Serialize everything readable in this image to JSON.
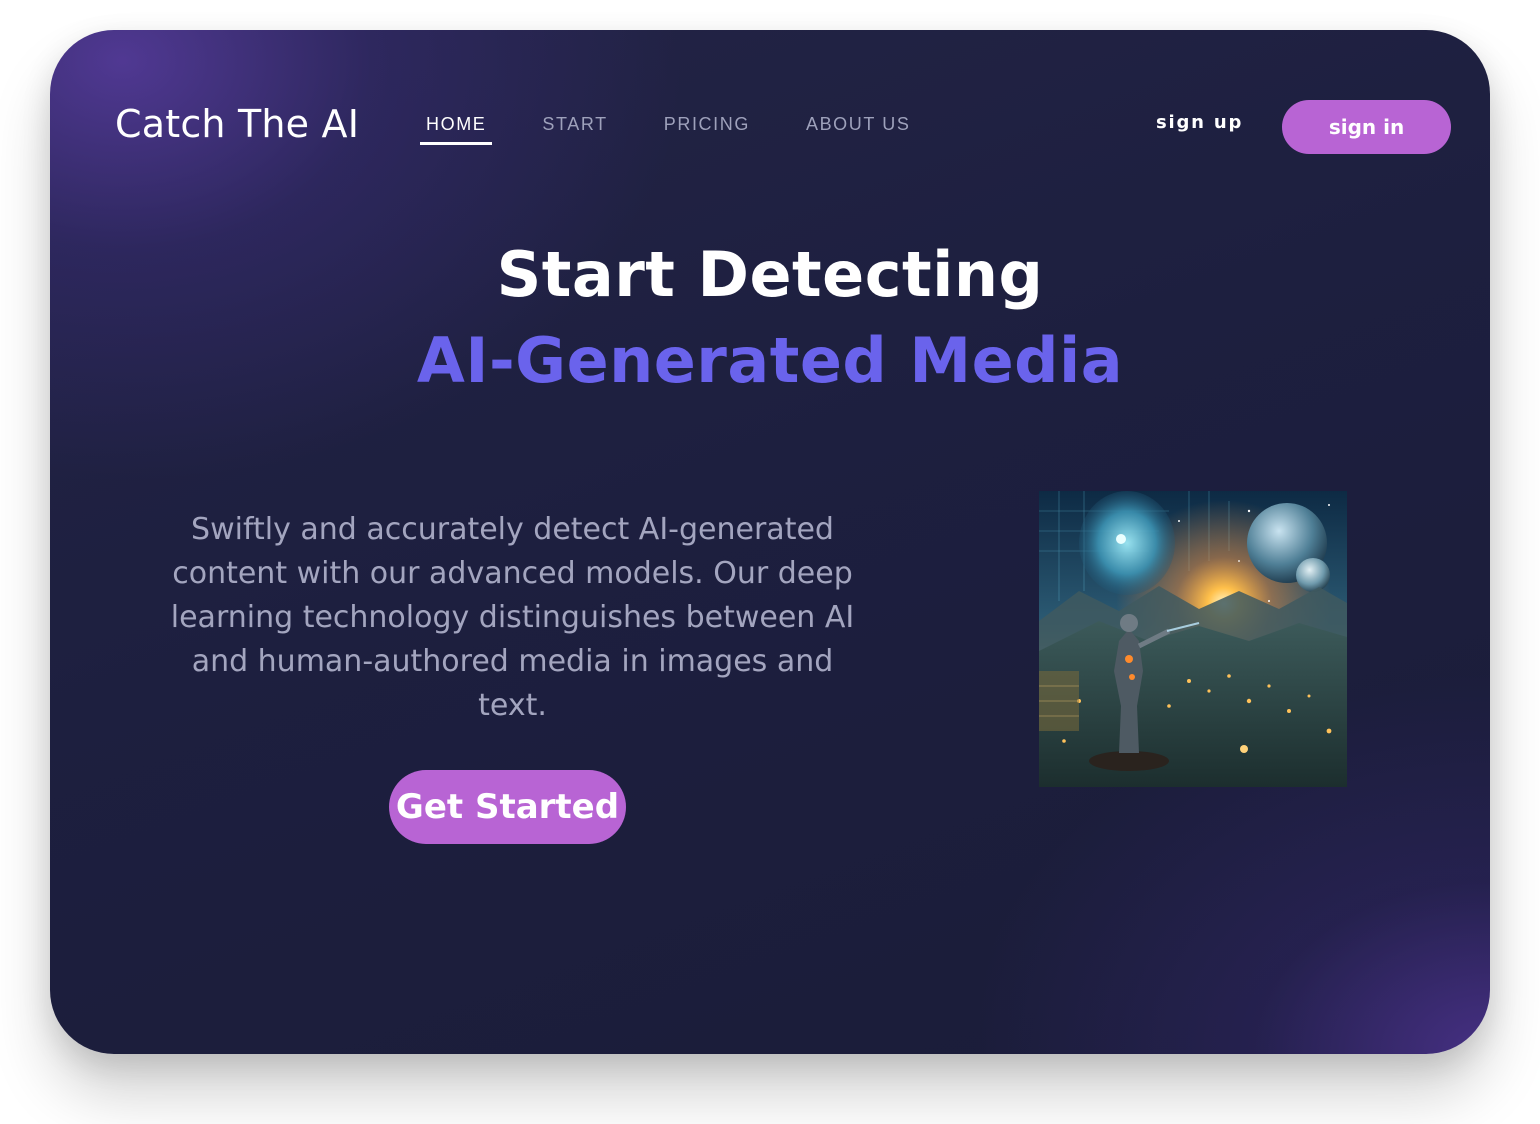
{
  "header": {
    "logo": "Catch The AI",
    "nav": [
      {
        "label": "HOME",
        "active": true
      },
      {
        "label": "START",
        "active": false
      },
      {
        "label": "PRICING",
        "active": false
      },
      {
        "label": "ABOUT US",
        "active": false
      }
    ],
    "signup_label": "sign up",
    "signin_label": "sign in"
  },
  "hero": {
    "title_line1": "Start Detecting",
    "title_line2": "AI-Generated Media",
    "description": "Swiftly and accurately detect AI-generated content with our advanced models. Our deep learning technology distinguishes between AI and human-authored media in images and text.",
    "cta_label": "Get Started",
    "image_icon": "ai-robot-landscape-illustration"
  },
  "colors": {
    "accent": "#b864d4",
    "title_highlight": "#6a63ec",
    "background_dark": "#1d1f3f",
    "muted_text": "#a3a5bf"
  }
}
